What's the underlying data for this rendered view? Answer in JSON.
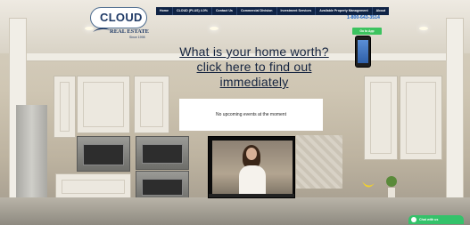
{
  "brand": {
    "name": "CLOUD",
    "subtitle": "REAL ESTATE",
    "since": "Since 1998"
  },
  "nav": {
    "items": [
      {
        "label": "Home"
      },
      {
        "label": "CLOUD (PLUS) 4.0%"
      },
      {
        "label": "Contact Us"
      },
      {
        "label": "Commercial Division"
      },
      {
        "label": "Investment Services"
      },
      {
        "label": "Available Property Management"
      },
      {
        "label": "About"
      }
    ]
  },
  "header": {
    "phone": "1-800-643-3514",
    "cta_label": "Go to App"
  },
  "hero": {
    "headline": "What is your home worth? click here to find out immediately"
  },
  "events": {
    "message": "No upcoming events at the moment"
  },
  "chat": {
    "label": "Chat with us"
  },
  "colors": {
    "nav_bg": "#0f2345",
    "phone": "#1b63c7",
    "cta": "#3cc35f",
    "hero_text": "#14233f"
  }
}
